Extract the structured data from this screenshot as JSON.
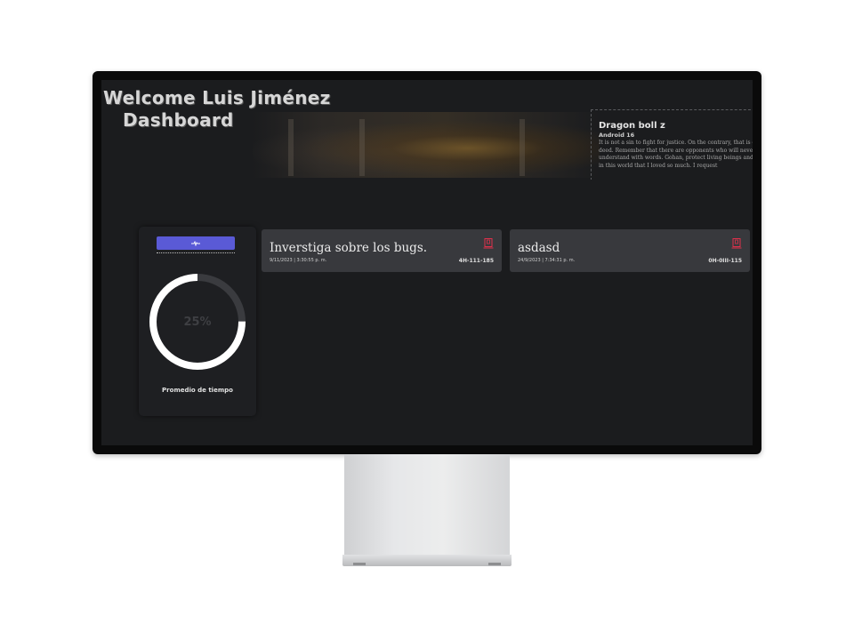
{
  "header": {
    "welcome": "Welcome Luis Jiménez",
    "title": "Dashboard"
  },
  "info_card": {
    "title": "Dragon boll z",
    "subtitle": "Android 16",
    "text": "It is not a sin to fight for justice. On the contrary, that is good deed. Remember that there are opponents who will never understand with words. Gohan, protect living beings and planet in this world that I loved so much. I request"
  },
  "progress": {
    "value": 25,
    "label": "25%",
    "caption": "Promedio de tiempo",
    "icon": "pulse-icon",
    "button_color": "#5a5ad6"
  },
  "tasks": [
    {
      "title": "Inverstiga sobre los bugs.",
      "date": "9/11/2023 | 3:30:55 p. m.",
      "code": "4H-111-185",
      "icon": "trash-icon"
    },
    {
      "title": "asdasd",
      "date": "24/9/2023 | 7:34:31 p. m.",
      "code": "0H-0III-115",
      "icon": "trash-icon"
    }
  ],
  "colors": {
    "accent": "#5a5ad6",
    "delete": "#e0314b",
    "background": "#1b1c1e",
    "card": "#38393d"
  }
}
